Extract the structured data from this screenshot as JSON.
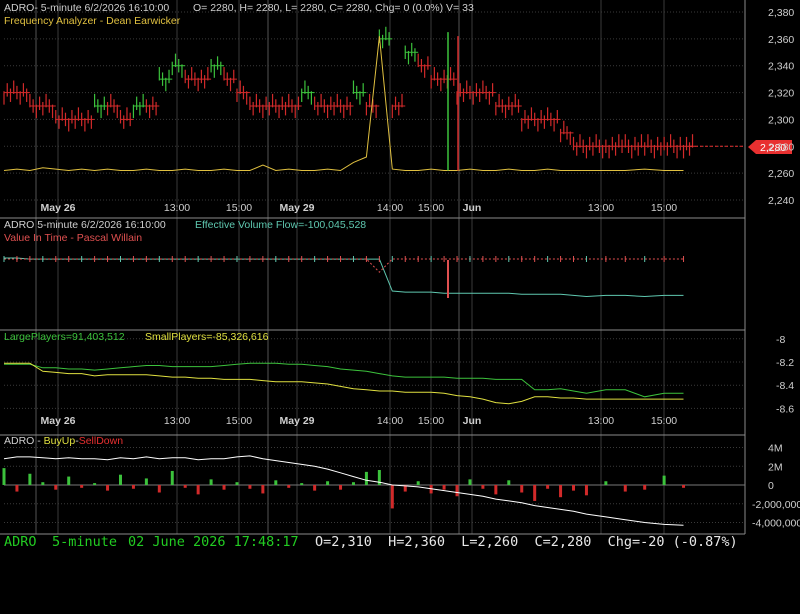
{
  "colors": {
    "background": "#000000",
    "grid": "#3a3a3a",
    "border": "#8a8a8a",
    "axis_text": "#cfcfcf",
    "bar_up": "#3cc23c",
    "bar_down": "#d22a2a",
    "analyzer": "#e0c040",
    "evf": "#5fc8b0",
    "vit": "#e05050",
    "large_players": "#3cc23c",
    "small_players": "#e0e040",
    "buyup": "#3cc23c",
    "selldown": "#d22a2a",
    "cumulative": "#ffffff",
    "price_tag": "#e83030",
    "status_green": "#22cc22",
    "status_white": "#e8e8e8"
  },
  "panels": {
    "price": {
      "header_prefix": "ADRO- 5-minute 6/2/2026 16:10:00",
      "header_values": "O= 2280, H= 2280, L= 2280, C= 2280, Chg= 0 (0.0%) V= 33",
      "indicator_label": "Frequency Analyzer - Dean Earwicker",
      "last_price_tag": "2,280"
    },
    "volume_flow": {
      "header_prefix": "ADRO 5-minute  6/2/2026 16:10:00",
      "evf_label": "Effective Volume Flow=-100,045,528",
      "vit_label": "Value In Time - Pascal Willain"
    },
    "players": {
      "large_label": "LargePlayers=91,403,512",
      "small_label": "SmallPlayers=-85,326,616"
    },
    "buyup": {
      "prefix": "ADRO - ",
      "buy_label": "BuyUp",
      "dash": "-",
      "sell_label": "SellDown"
    }
  },
  "x_axis_labels_1": [
    "May 26",
    "13:00",
    "15:00",
    "May 29",
    "14:00",
    "15:00",
    "Jun",
    "13:00",
    "15:00"
  ],
  "x_axis_labels_2": [
    "May 26",
    "13:00",
    "15:00",
    "May 29",
    "14:00",
    "15:00",
    "Jun",
    "13:00",
    "15:00"
  ],
  "status_bar": {
    "symbol": "ADRO",
    "interval": "5-minute",
    "datetime": "02 June 2026 17:48:17",
    "ohlc": "O=2,310  H=2,360  L=2,260  C=2,280  Chg=-20 (-0.87%)"
  },
  "chart_data": [
    {
      "type": "bar",
      "title": "ADRO- 5-minute",
      "yticks": [
        "2,380",
        "2,360",
        "2,340",
        "2,320",
        "2,300",
        "2,280",
        "2,260",
        "2,240"
      ],
      "ylim": [
        2240,
        2380
      ],
      "x_sessions": [
        "May 26",
        "May 29",
        "Jun"
      ],
      "close_series": {
        "name": "ADRO",
        "x": [
          0,
          4,
          8,
          12,
          16,
          20,
          24,
          28,
          32,
          36,
          40,
          44,
          48,
          52,
          56,
          60,
          64,
          68,
          72,
          76,
          80,
          84,
          88,
          92,
          96,
          100,
          104,
          108,
          112,
          116,
          120,
          124,
          128,
          132,
          136,
          140,
          144,
          148,
          152,
          156,
          160,
          164,
          168,
          172,
          176,
          180,
          186,
          192,
          198,
          204,
          210
        ],
        "values": [
          2320,
          2320,
          2310,
          2310,
          2300,
          2300,
          2300,
          2310,
          2310,
          2300,
          2310,
          2310,
          2330,
          2340,
          2330,
          2330,
          2340,
          2330,
          2320,
          2310,
          2310,
          2310,
          2310,
          2320,
          2310,
          2310,
          2310,
          2320,
          2310,
          2360,
          2310,
          2350,
          2340,
          2330,
          2330,
          2320,
          2320,
          2320,
          2310,
          2310,
          2300,
          2300,
          2300,
          2290,
          2280,
          2280,
          2280,
          2280,
          2280,
          2280,
          2280
        ]
      },
      "overlay": {
        "name": "Frequency Analyzer - Dean Earwicker",
        "values": [
          2262,
          2263,
          2262,
          2264,
          2263,
          2262,
          2263,
          2262,
          2263,
          2262,
          2262,
          2263,
          2262,
          2262,
          2263,
          2262,
          2262,
          2263,
          2262,
          2262,
          2266,
          2262,
          2263,
          2262,
          2262,
          2263,
          2262,
          2268,
          2272,
          2362,
          2263,
          2262,
          2262,
          2263,
          2262,
          2262,
          2263,
          2262,
          2262,
          2263,
          2262,
          2262,
          2263,
          2262,
          2262,
          2262,
          2262,
          2262,
          2263,
          2262,
          2262
        ]
      }
    },
    {
      "type": "line",
      "title": "Effective Volume Flow / Value In Time",
      "series": [
        {
          "name": "Effective Volume Flow",
          "values": [
            0,
            0,
            -1,
            -1,
            -1,
            -1,
            -1,
            -1,
            -1,
            -1,
            -1,
            -1,
            -1,
            -1,
            -1,
            -1,
            -1,
            -1,
            -1,
            -1,
            -1,
            -1,
            -1,
            -1,
            -1,
            -1,
            -1,
            -1,
            -1,
            -1,
            -30,
            -31,
            -31,
            -31,
            -32,
            -32,
            -32,
            -32,
            -32,
            -32,
            -33,
            -33,
            -33,
            -33,
            -34,
            -35,
            -34,
            -34,
            -35,
            -34,
            -34
          ]
        },
        {
          "name": "Value In Time",
          "values": [
            0,
            0,
            0,
            0,
            0,
            0,
            0,
            0,
            0,
            0,
            0,
            0,
            0,
            0,
            0,
            0,
            0,
            0,
            0,
            0,
            0,
            0,
            0,
            0,
            0,
            0,
            0,
            0,
            0,
            -12,
            0,
            0,
            0,
            0,
            0,
            0,
            0,
            0,
            0,
            0,
            0,
            0,
            0,
            0,
            0,
            0,
            0,
            0,
            0,
            0,
            0
          ]
        }
      ]
    },
    {
      "type": "line",
      "title": "LargePlayers / SmallPlayers",
      "yticks": [
        "-8",
        "-8.2",
        "-8.4",
        "-8.6"
      ],
      "ylim": [
        -8.7,
        -7.95
      ],
      "series": [
        {
          "name": "LargePlayers",
          "values": [
            -8.22,
            -8.22,
            -8.22,
            -8.25,
            -8.25,
            -8.26,
            -8.26,
            -8.27,
            -8.26,
            -8.25,
            -8.24,
            -8.23,
            -8.23,
            -8.24,
            -8.24,
            -8.24,
            -8.24,
            -8.23,
            -8.22,
            -8.21,
            -8.21,
            -8.21,
            -8.22,
            -8.22,
            -8.23,
            -8.24,
            -8.26,
            -8.27,
            -8.28,
            -8.3,
            -8.32,
            -8.33,
            -8.33,
            -8.33,
            -8.33,
            -8.34,
            -8.34,
            -8.34,
            -8.35,
            -8.35,
            -8.35,
            -8.44,
            -8.44,
            -8.43,
            -8.45,
            -8.47,
            -8.44,
            -8.44,
            -8.5,
            -8.47,
            -8.47
          ]
        },
        {
          "name": "SmallPlayers",
          "values": [
            -8.21,
            -8.21,
            -8.21,
            -8.28,
            -8.29,
            -8.3,
            -8.3,
            -8.32,
            -8.31,
            -8.31,
            -8.31,
            -8.31,
            -8.32,
            -8.33,
            -8.33,
            -8.34,
            -8.34,
            -8.35,
            -8.35,
            -8.35,
            -8.36,
            -8.37,
            -8.37,
            -8.37,
            -8.38,
            -8.39,
            -8.41,
            -8.43,
            -8.44,
            -8.45,
            -8.45,
            -8.46,
            -8.46,
            -8.46,
            -8.47,
            -8.49,
            -8.5,
            -8.52,
            -8.55,
            -8.56,
            -8.54,
            -8.5,
            -8.5,
            -8.51,
            -8.51,
            -8.52,
            -8.52,
            -8.52,
            -8.52,
            -8.52,
            -8.52
          ]
        }
      ]
    },
    {
      "type": "bar",
      "title": "ADRO - BuyUp-SellDown",
      "yticks": [
        "4M",
        "2M",
        "0",
        "-2,000,000",
        "-4,000,000"
      ],
      "ylim": [
        -4800000,
        4800000
      ],
      "series": [
        {
          "name": "BuyUp-SellDown",
          "values": [
            1800000,
            -700000,
            1200000,
            300000,
            -500000,
            900000,
            -300000,
            200000,
            -600000,
            1100000,
            -400000,
            700000,
            -800000,
            1500000,
            -300000,
            -1000000,
            600000,
            -500000,
            300000,
            -400000,
            -900000,
            500000,
            -300000,
            200000,
            -600000,
            400000,
            -500000,
            300000,
            1400000,
            1600000,
            -2500000,
            -700000,
            400000,
            -900000,
            -500000,
            -1200000,
            600000,
            -400000,
            -1000000,
            500000,
            -800000,
            -1700000,
            -400000,
            -1300000,
            -600000,
            -1100000,
            400000,
            -700000,
            -500000,
            1000000,
            -300000
          ]
        },
        {
          "name": "Cumulative",
          "values": [
            2800000,
            3000000,
            3000000,
            2900000,
            2800000,
            2900000,
            2800000,
            2800000,
            2700000,
            2900000,
            2800000,
            3000000,
            2800000,
            2900000,
            2900000,
            2700000,
            2800000,
            2800000,
            3000000,
            3100000,
            2800000,
            2600000,
            2400000,
            2200000,
            2000000,
            1700000,
            1300000,
            900000,
            500000,
            300000,
            0,
            -100000,
            -200000,
            -400000,
            -600000,
            -800000,
            -1000000,
            -1200000,
            -1500000,
            -1700000,
            -1900000,
            -2200000,
            -2400000,
            -2600000,
            -2800000,
            -3100000,
            -3400000,
            -3700000,
            -4000000,
            -4200000,
            -4300000
          ]
        }
      ]
    }
  ]
}
